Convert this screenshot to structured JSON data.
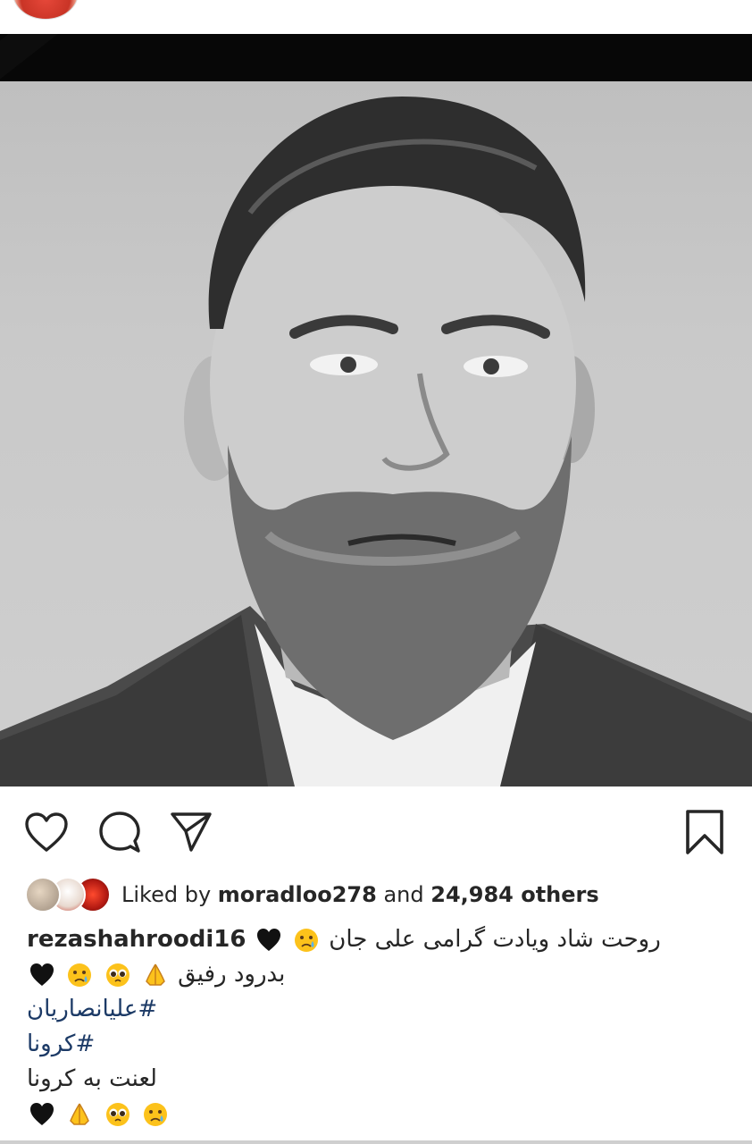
{
  "post": {
    "likes": {
      "prefix": "Liked by",
      "user": "moradloo278",
      "connector": "and",
      "others": "24,984 others"
    },
    "caption": {
      "username": "rezashahroodi16",
      "line1_text": "روحت شاد ویادت گرامی علی جان",
      "line2_text": "بدرود رفیق",
      "hashtag1": "#علیانصاریان",
      "hashtag2": "#کرونا",
      "line5_text": "لعنت به کرونا"
    },
    "emoji": {
      "line1": [
        "black-heart",
        "crying-face"
      ],
      "line2": [
        "folded-hands",
        "pleading-face",
        "crying-face",
        "black-heart"
      ],
      "line6": [
        "black-heart",
        "folded-hands",
        "pleading-face",
        "crying-face"
      ]
    }
  },
  "colors": {
    "hashtag": "#1c3a66",
    "text": "#262626"
  }
}
